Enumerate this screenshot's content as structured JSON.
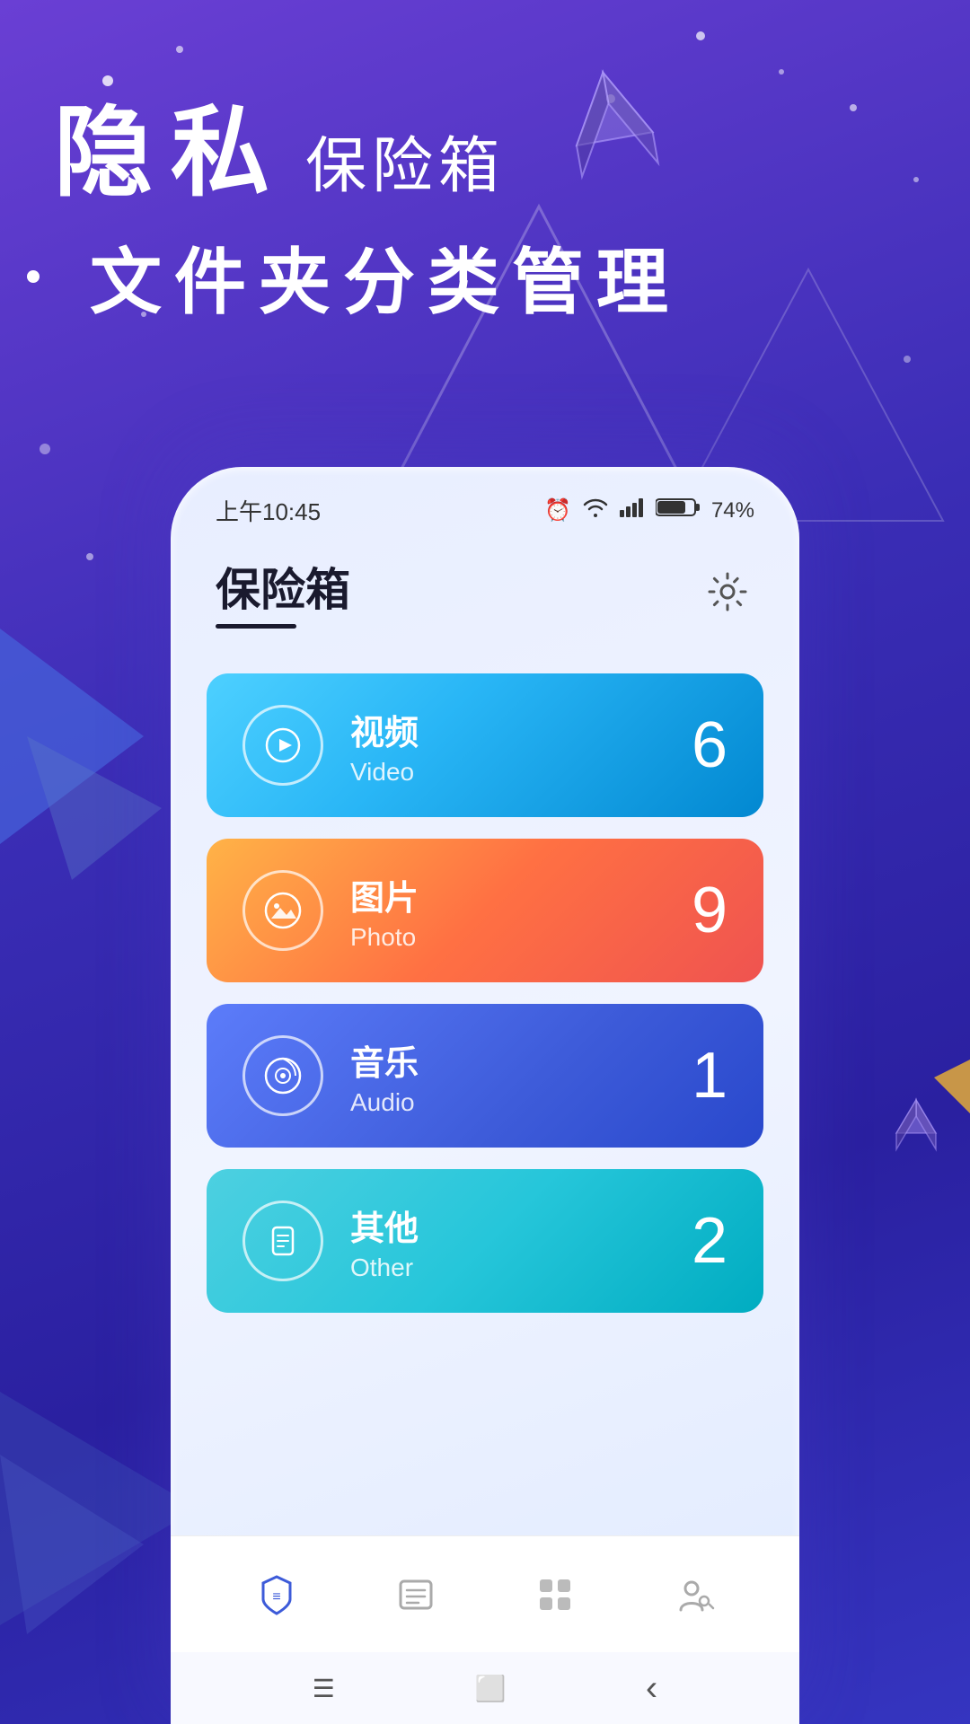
{
  "background": {
    "gradient_start": "#6a3fd4",
    "gradient_end": "#2a20a0"
  },
  "header": {
    "line1_big": "隐私",
    "line1_small": "保险箱",
    "line2": "文件夹分类管理"
  },
  "status_bar": {
    "time": "上午10:45",
    "battery": "74%"
  },
  "app": {
    "title": "保险箱",
    "settings_label": "⚙"
  },
  "categories": [
    {
      "name_zh": "视频",
      "name_en": "Video",
      "count": "6",
      "icon": "▶",
      "card_class": "card-video"
    },
    {
      "name_zh": "图片",
      "name_en": "Photo",
      "count": "9",
      "icon": "⛰",
      "card_class": "card-photo"
    },
    {
      "name_zh": "音乐",
      "name_en": "Audio",
      "count": "1",
      "icon": "♫",
      "card_class": "card-audio"
    },
    {
      "name_zh": "其他",
      "name_en": "Other",
      "count": "2",
      "icon": "≡",
      "card_class": "card-other"
    }
  ],
  "bottom_nav": [
    {
      "icon": "shield",
      "active": true
    },
    {
      "icon": "list",
      "active": false
    },
    {
      "icon": "apps",
      "active": false
    },
    {
      "icon": "person",
      "active": false
    }
  ],
  "system_nav": {
    "menu": "☰",
    "home": "⬜",
    "back": "‹"
  }
}
